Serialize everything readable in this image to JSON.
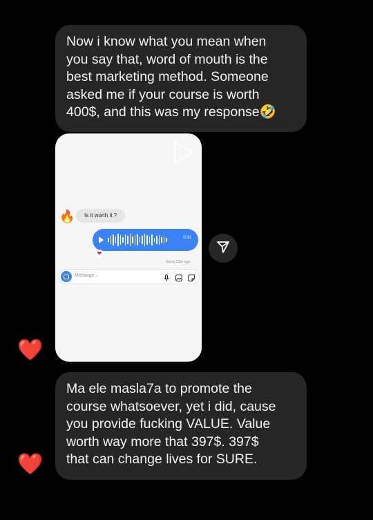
{
  "messages": [
    {
      "text": "Now i know what you mean when\nyou say that, word of mouth is the\nbest marketing method. Someone\nasked me if your course is worth\n400$, and this was my response🤣"
    },
    {
      "text": "Ma ele masla7a to promote the\ncourse whatsoever, yet i did, cause\nyou provide fucking VALUE. Value\nworth way more that 397$. 397$\nthat can change lives for SURE."
    }
  ],
  "reactions": [
    "❤️",
    "❤️"
  ],
  "screenshot": {
    "avatar": "🔥",
    "question": "Is it worth it ?",
    "voice_duration": "0:31",
    "voice_reaction": "❤",
    "seen": "Seen 13m ago",
    "compose_placeholder": "Message..."
  },
  "icons": [
    "play-icon",
    "share-icon",
    "camera-icon",
    "microphone-icon",
    "gallery-icon",
    "sticker-icon"
  ]
}
